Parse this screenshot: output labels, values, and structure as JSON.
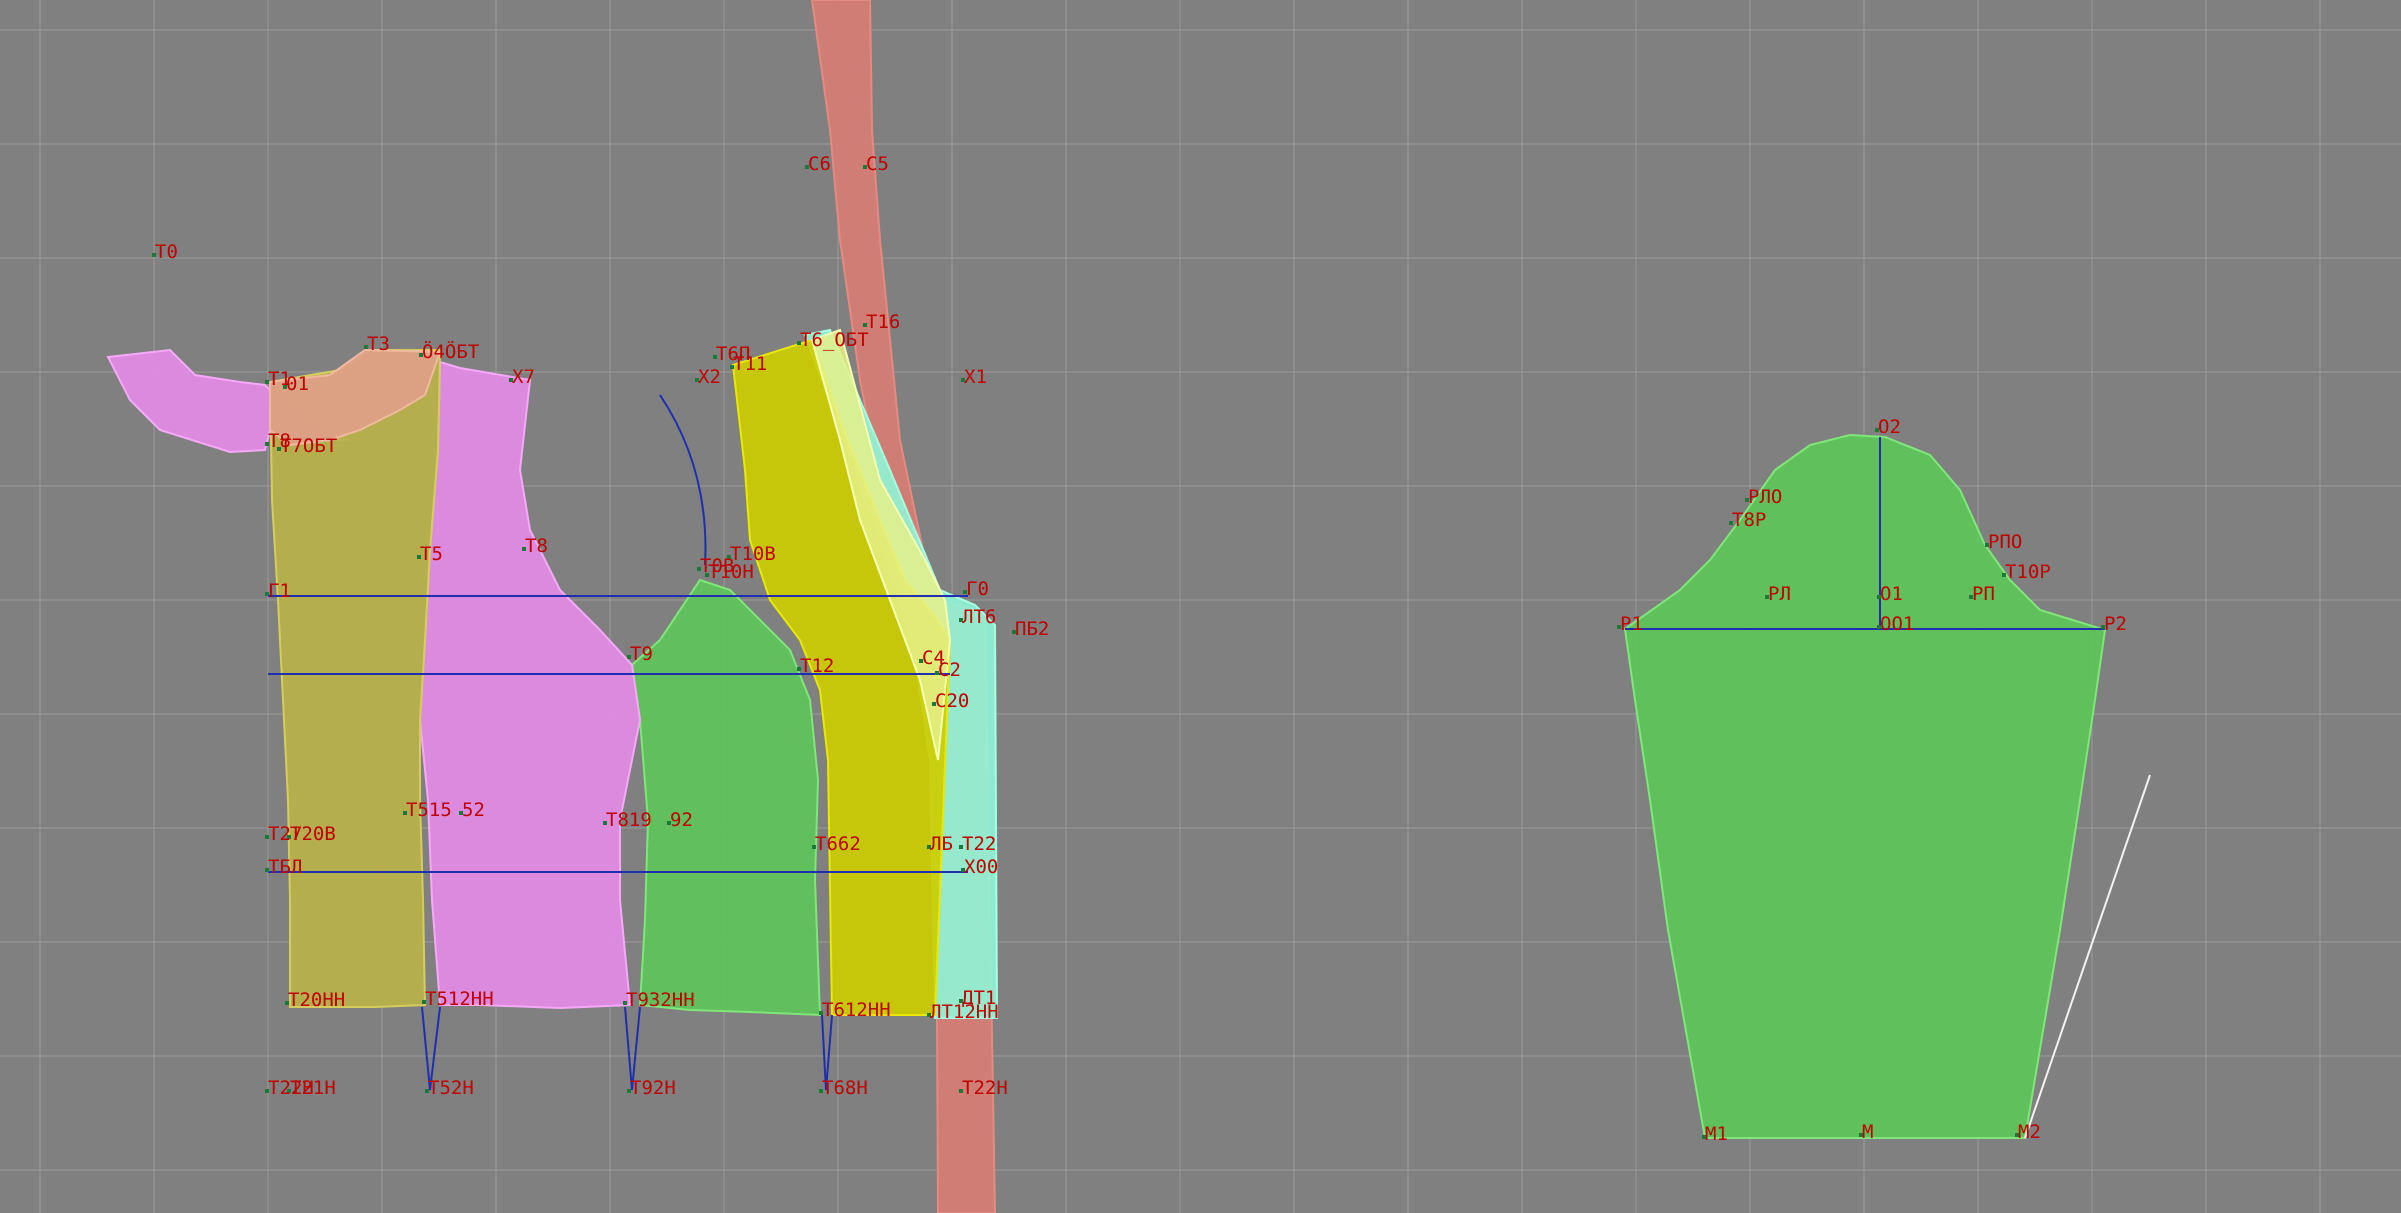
{
  "colors": {
    "background": "#808080",
    "grid": "#9a9a9a",
    "label": "#c00000",
    "construction_line": "#1f2fb0",
    "pink_piece": "#e48be6",
    "yellow_piece": "#cdcd00",
    "olive_piece": "#b7b04a",
    "green_piece": "#5ec45a",
    "red_strip": "#d87c74",
    "cyan_strip": "#8ff5d6",
    "facing_piece": "#e0a08a",
    "white_line": "#f2f2f2"
  },
  "labels": {
    "t0": "T0",
    "t3": "T3",
    "t1": "T1",
    "t01": "01",
    "t4obt": "Ö4ÖБТ",
    "x7": "X7",
    "t8top": "T8",
    "t7obt": "Т7ОБТ",
    "t5": "T5",
    "t8": "T8",
    "g1": "Г1",
    "t9": "T9",
    "t27": "T27",
    "t20v": "T20В",
    "t515": "T515",
    "t52": "52",
    "t819": "T819",
    "t92": "92",
    "tbl": "TБЛ",
    "t20nn": "T20НН",
    "t512nn": "T512НН",
    "t932nn": "T932НН",
    "t22n": "T22Н",
    "t21n": "T21Н",
    "t52n": "T52Н",
    "t92n": "T92Н",
    "c6": "C6",
    "c5": "C5",
    "t16": "T16",
    "t6obt": "T6_ОБТ",
    "t6p": "T6П",
    "t11": "T11",
    "x2": "X2",
    "x1": "X1",
    "t10v": "T10В",
    "t0v": "T0В",
    "t10n": "T10Н",
    "g0": "Г0",
    "lt6": "ЛТ6",
    "pb2": "ПБ2",
    "t12": "T12",
    "c4": "C4",
    "c2": "C2",
    "c20": "C20",
    "t662": "T662",
    "lb": "ЛБ",
    "t22": "T22",
    "x00": "X00",
    "t612nn": "T612НН",
    "lt12nn": "ЛТ12НН",
    "dt1": "ДТ1",
    "t68n": "T68Н",
    "t22nb": "T22Н",
    "o2": "O2",
    "rlo": "РЛО",
    "t8r": "T8Р",
    "rpo": "РПО",
    "t10r": "T10Р",
    "rl": "РЛ",
    "o1": "O1",
    "rp": "РП",
    "r1": "Р1",
    "oo1": "ОО1",
    "r2": "Р2",
    "m1": "М1",
    "m": "М",
    "m2": "М2"
  }
}
